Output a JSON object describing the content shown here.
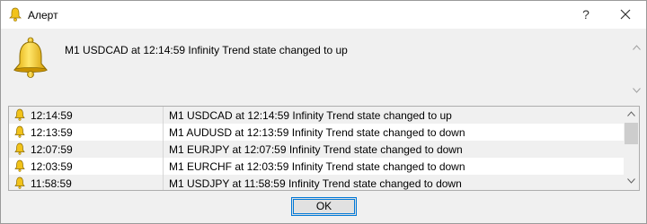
{
  "window": {
    "title": "Алерт"
  },
  "titlebar": {
    "help_label": "?"
  },
  "message": {
    "text": "M1 USDCAD at 12:14:59 Infinity Trend state changed to  up"
  },
  "alerts": [
    {
      "time": "12:14:59",
      "message": "M1 USDCAD at 12:14:59 Infinity Trend state changed to  up"
    },
    {
      "time": "12:13:59",
      "message": "M1 AUDUSD at 12:13:59 Infinity Trend state changed to  down"
    },
    {
      "time": "12:07:59",
      "message": "M1 EURJPY at 12:07:59 Infinity Trend state changed to  down"
    },
    {
      "time": "12:03:59",
      "message": "M1 EURCHF at 12:03:59 Infinity Trend state changed to  down"
    },
    {
      "time": "11:58:59",
      "message": "M1 USDJPY at 11:58:59 Infinity Trend state changed to  down"
    }
  ],
  "buttons": {
    "ok_label": "OK"
  },
  "colors": {
    "accent": "#0078d7",
    "bell": "#f2c31a",
    "selected_row": "#f0f0f0"
  },
  "icons": {
    "title": "bell-icon",
    "message": "bell-icon",
    "row": "bell-icon",
    "close": "close-icon"
  }
}
